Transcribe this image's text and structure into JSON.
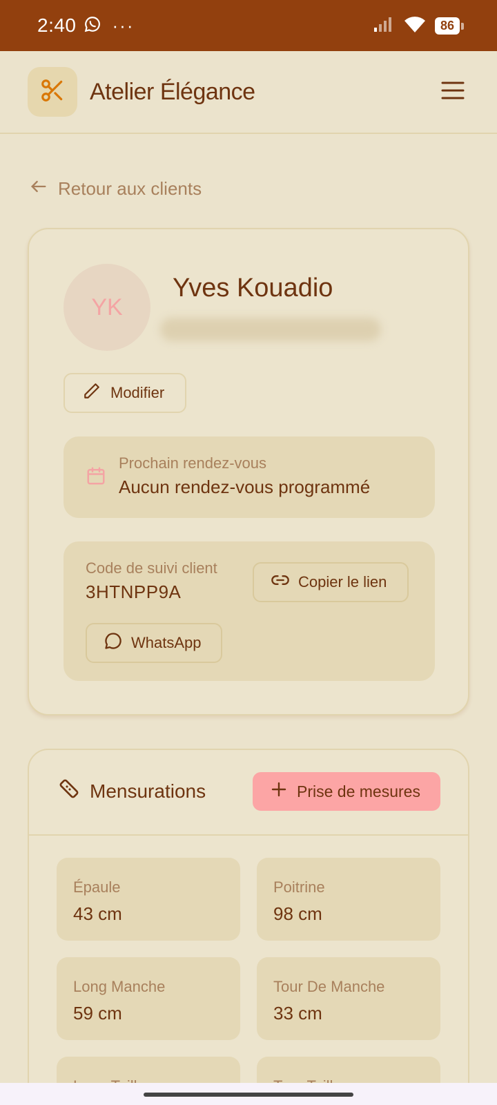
{
  "status_bar": {
    "time": "2:40",
    "battery": "86",
    "more": "···"
  },
  "header": {
    "title": "Atelier Élégance"
  },
  "back_link": {
    "label": "Retour aux clients"
  },
  "client": {
    "initials": "YK",
    "name": "Yves Kouadio",
    "edit_label": "Modifier",
    "appointment": {
      "label": "Prochain rendez-vous",
      "value": "Aucun rendez-vous programmé"
    },
    "tracking": {
      "label": "Code de suivi client",
      "code": "3HTNPP9A",
      "copy_label": "Copier le lien",
      "whatsapp_label": "WhatsApp"
    }
  },
  "measurements": {
    "title": "Mensurations",
    "add_label": "Prise de mesures",
    "items": [
      {
        "label": "Épaule",
        "value": "43 cm"
      },
      {
        "label": "Poitrine",
        "value": "98 cm"
      },
      {
        "label": "Long Manche",
        "value": "59 cm"
      },
      {
        "label": "Tour De Manche",
        "value": "33 cm"
      },
      {
        "label": "Long Taille",
        "value": ""
      },
      {
        "label": "Tour Taille",
        "value": ""
      }
    ]
  },
  "colors": {
    "brand": "#92400e",
    "accent": "#fca5a5",
    "background": "#ebe3cc"
  }
}
